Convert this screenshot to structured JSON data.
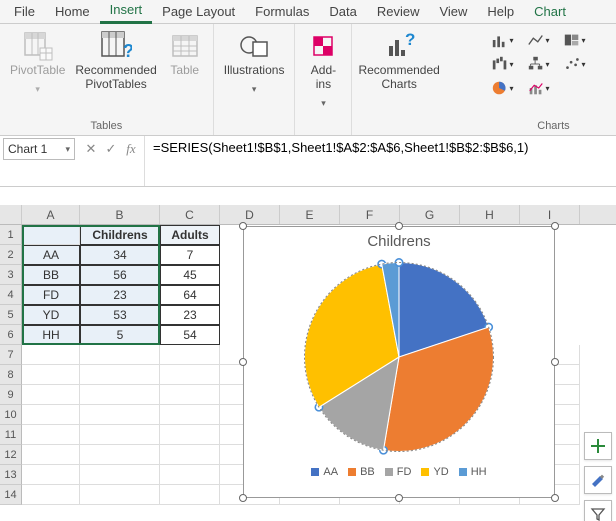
{
  "tabs": {
    "file": "File",
    "home": "Home",
    "insert": "Insert",
    "page_layout": "Page Layout",
    "formulas": "Formulas",
    "data": "Data",
    "review": "Review",
    "view": "View",
    "help": "Help",
    "chart": "Chart"
  },
  "ribbon": {
    "tables": {
      "pivot": "PivotTable",
      "recommended_pivot": "Recommended\nPivotTables",
      "table": "Table",
      "group": "Tables"
    },
    "illustrations": {
      "label": "Illustrations"
    },
    "addins": {
      "label": "Add-\nins"
    },
    "charts": {
      "recommended": "Recommended\nCharts",
      "group": "Charts"
    }
  },
  "namebox": "Chart 1",
  "formula": "=SERIES(Sheet1!$B$1,Sheet1!$A$2:$A$6,Sheet1!$B$2:$B$6,1)",
  "columns": [
    "A",
    "B",
    "C",
    "D",
    "E",
    "F",
    "G",
    "H",
    "I"
  ],
  "sheet": {
    "headers": {
      "a": "",
      "b": "Childrens",
      "c": "Adults"
    },
    "rows": [
      {
        "a": "AA",
        "b": "34",
        "c": "7"
      },
      {
        "a": "BB",
        "b": "56",
        "c": "45"
      },
      {
        "a": "FD",
        "b": "23",
        "c": "64"
      },
      {
        "a": "YD",
        "b": "53",
        "c": "23"
      },
      {
        "a": "HH",
        "b": "5",
        "c": "54"
      }
    ]
  },
  "chart_data": {
    "type": "pie",
    "title": "Childrens",
    "categories": [
      "AA",
      "BB",
      "FD",
      "YD",
      "HH"
    ],
    "values": [
      34,
      56,
      23,
      53,
      5
    ],
    "colors": [
      "#4472C4",
      "#ED7D31",
      "#A5A5A5",
      "#FFC000",
      "#5B9BD5"
    ]
  }
}
